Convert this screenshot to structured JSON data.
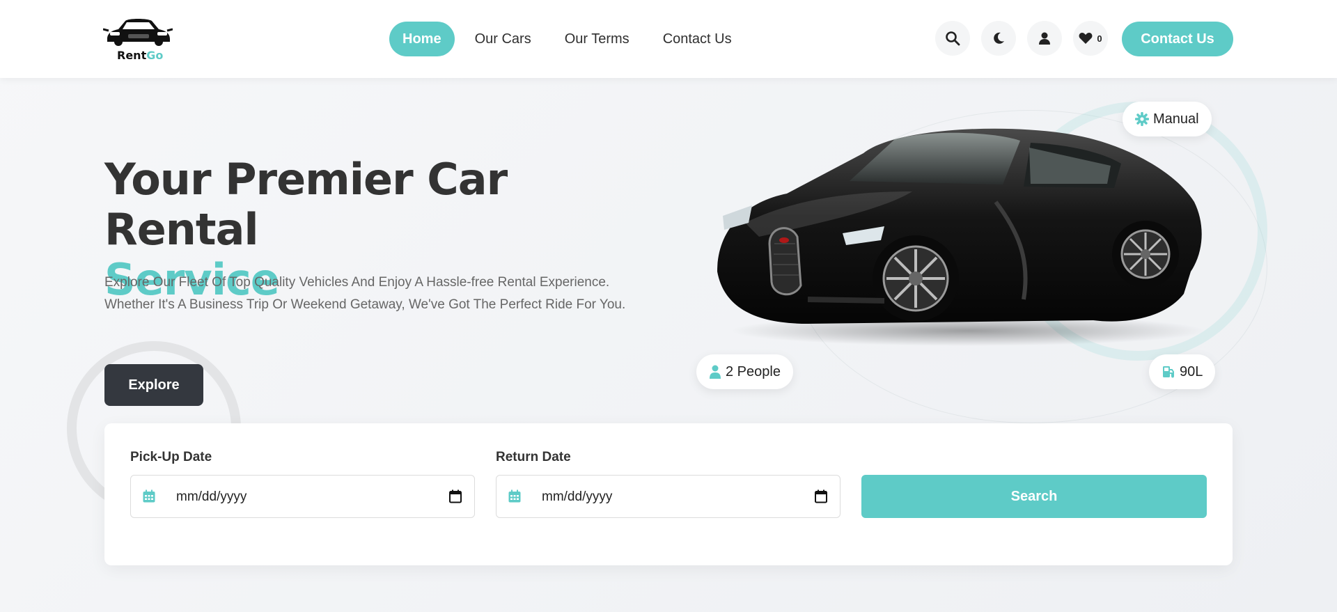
{
  "brand": {
    "name_part1": "Rent",
    "name_part2": "Go"
  },
  "nav": {
    "links": [
      {
        "label": "Home",
        "active": true
      },
      {
        "label": "Our Cars",
        "active": false
      },
      {
        "label": "Our Terms",
        "active": false
      },
      {
        "label": "Contact Us",
        "active": false
      }
    ],
    "icons": [
      "search-icon",
      "moon-icon",
      "user-icon",
      "heart-icon"
    ],
    "wishlist_count": "0",
    "cta_label": "Contact Us"
  },
  "hero": {
    "title_line1": "Your Premier Car Rental",
    "title_line2": "Service",
    "description": "Explore Our Fleet Of Top Quality Vehicles And Enjoy A Hassle-free Rental Experience. Whether It's A Business Trip Or Weekend Getaway, We've Got The Perfect Ride For You.",
    "explore_label": "Explore"
  },
  "car": {
    "transmission": "Manual",
    "capacity": "2 People",
    "fuel": "90L"
  },
  "booking": {
    "pickup_label": "Pick-Up Date",
    "pickup_placeholder": "mm/dd/yyyy",
    "return_label": "Return Date",
    "return_placeholder": "mm/dd/yyyy",
    "search_label": "Search"
  },
  "colors": {
    "accent": "#5ecbc7",
    "dark": "#34383f",
    "text": "#333333"
  }
}
